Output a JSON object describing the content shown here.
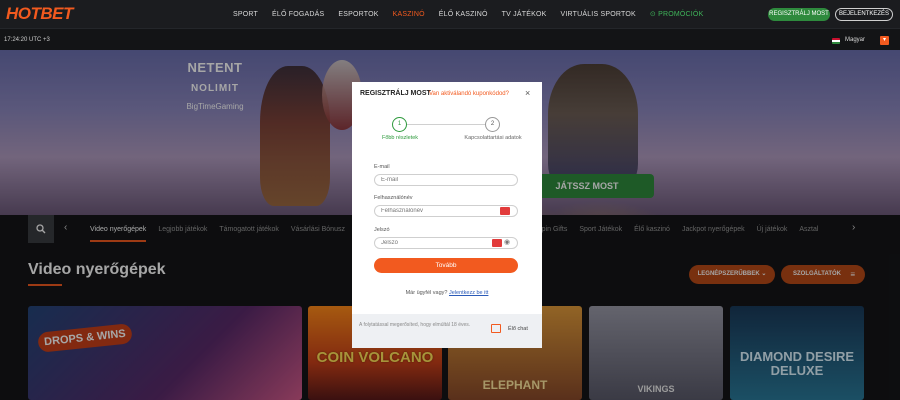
{
  "header": {
    "logo": "HOTBET",
    "nav": [
      "SPORT",
      "ÉLŐ FOGADÁS",
      "ESPORTOK",
      "KASZINÓ",
      "ÉLŐ KASZINÓ",
      "TV JÁTÉKOK",
      "VIRTUÁLIS SPORTOK",
      "PROMÓCIÓK"
    ],
    "active_nav": "KASZINÓ",
    "register_label": "REGISZTRÁLJ MOST",
    "login_label": "BEJELENTKEZÉS"
  },
  "subbar": {
    "clock": "17:24:20 UTC +3",
    "language": "Magyar"
  },
  "hero": {
    "providers": [
      "NETENT",
      "NOLIMIT",
      "BigTimeGaming"
    ],
    "cta": "JÁTSSZ MOST"
  },
  "categories": {
    "items": [
      "Video nyerőgépek",
      "Legjobb játékok",
      "Támogatott játékok",
      "Vásárlási Bónusz",
      "",
      "",
      "",
      "",
      "Spin Gifts",
      "Sport Játékok",
      "Élő kaszinó",
      "Jackpot nyerőgépek",
      "Új játékok",
      "Asztal"
    ],
    "active": "Video nyerőgépek"
  },
  "section": {
    "title": "Video nyerőgépek",
    "popular_btn": "LEGNÉPSZERŰBBEK",
    "providers_btn": "SZOLGÁLTATÓK"
  },
  "tiles": {
    "t1": "DROPS & WINS",
    "t2": "COIN VOLCANO",
    "t3": "ELEPHANT",
    "t4": "VIKINGS",
    "t5": "DIAMOND DESIRE DELUXE"
  },
  "modal": {
    "title": "REGISZTRÁLJ MOST",
    "coupon_link": "Van aktiválandó kuponkódod?",
    "close": "×",
    "step1_num": "1",
    "step1_label": "Főbb részletek",
    "step2_num": "2",
    "step2_label": "Kapcsolattartási adatok",
    "email_label": "E-mail",
    "email_placeholder": "E-mail",
    "username_label": "Felhasználónév",
    "username_placeholder": "Felhasználónév",
    "password_label": "Jelszó",
    "password_placeholder": "Jelszó",
    "next_btn": "Tovább",
    "have_account": "Már ügyfél vagy?",
    "login_link": "Jelentkezz be itt",
    "footer_note": "A folytatással megerősíted, hogy elmúltál 18 éves.",
    "chat": "Élő chat"
  },
  "colors": {
    "accent": "#f25a1f",
    "green": "#2e8a3d",
    "bg": "#141518"
  }
}
